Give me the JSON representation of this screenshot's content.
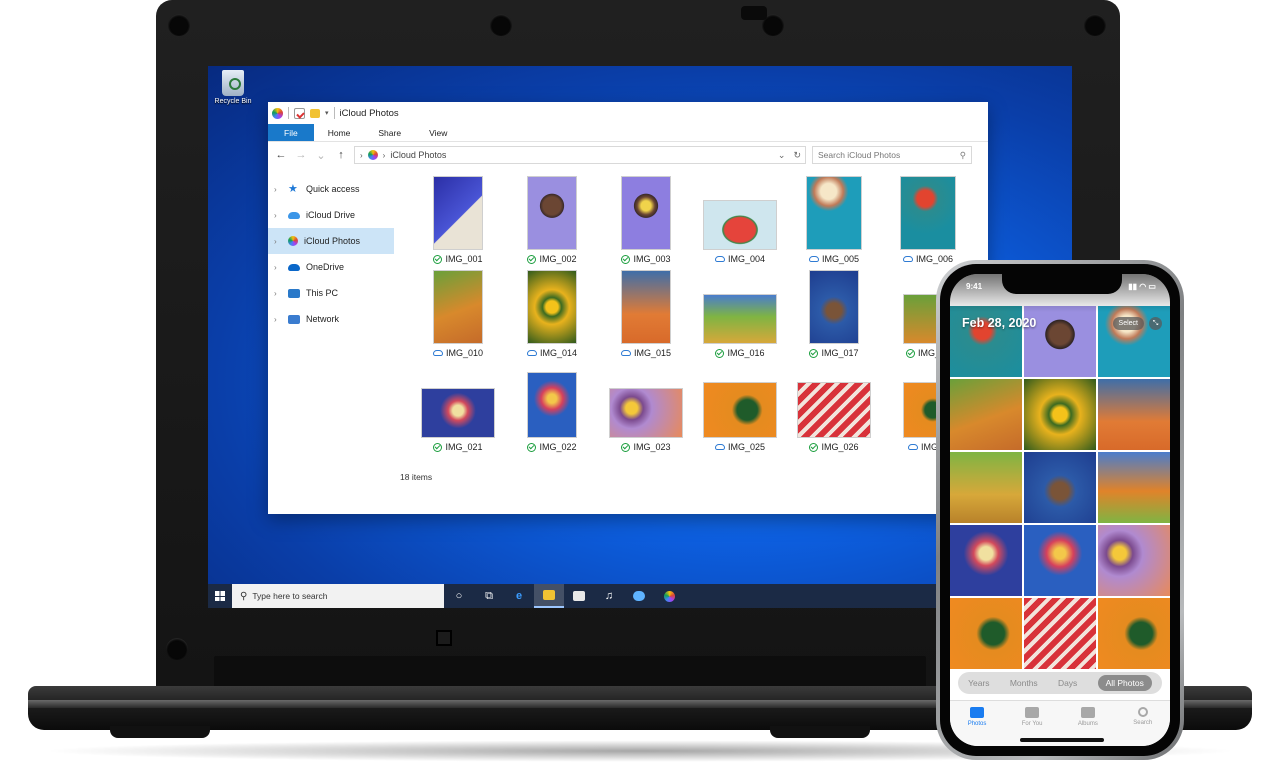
{
  "desktop": {
    "recycle_bin": "Recycle Bin"
  },
  "explorer": {
    "title": "iCloud Photos",
    "ribbon_tabs": [
      "File",
      "Home",
      "Share",
      "View"
    ],
    "address": "iCloud Photos",
    "search_placeholder": "Search iCloud Photos",
    "nav": [
      {
        "label": "Quick access",
        "icon": "star-icon"
      },
      {
        "label": "iCloud Drive",
        "icon": "cloud-icon"
      },
      {
        "label": "iCloud Photos",
        "icon": "photos-icon",
        "selected": true
      },
      {
        "label": "OneDrive",
        "icon": "onedrive-icon"
      },
      {
        "label": "This PC",
        "icon": "pc-icon"
      },
      {
        "label": "Network",
        "icon": "network-icon"
      }
    ],
    "files": [
      {
        "name": "IMG_001",
        "status": "synced"
      },
      {
        "name": "IMG_002",
        "status": "synced"
      },
      {
        "name": "IMG_003",
        "status": "synced"
      },
      {
        "name": "IMG_004",
        "status": "cloud"
      },
      {
        "name": "IMG_005",
        "status": "cloud"
      },
      {
        "name": "IMG_006",
        "status": "cloud"
      },
      {
        "name": "IMG_010",
        "status": "cloud"
      },
      {
        "name": "IMG_014",
        "status": "cloud"
      },
      {
        "name": "IMG_015",
        "status": "cloud"
      },
      {
        "name": "IMG_016",
        "status": "synced"
      },
      {
        "name": "IMG_017",
        "status": "synced"
      },
      {
        "name": "IMG_01",
        "status": "synced"
      },
      {
        "name": "IMG_021",
        "status": "synced"
      },
      {
        "name": "IMG_022",
        "status": "synced"
      },
      {
        "name": "IMG_023",
        "status": "synced"
      },
      {
        "name": "IMG_025",
        "status": "cloud"
      },
      {
        "name": "IMG_026",
        "status": "synced"
      },
      {
        "name": "IMG_0",
        "status": "cloud"
      }
    ],
    "status_text": "18 items"
  },
  "taskbar": {
    "search_placeholder": "Type here to search"
  },
  "phone": {
    "time": "9:41",
    "date_header": "Feb 28, 2020",
    "select_label": "Select",
    "segments": [
      "Years",
      "Months",
      "Days",
      "All Photos"
    ],
    "active_segment": "All Photos",
    "tabs": [
      "Photos",
      "For You",
      "Albums",
      "Search"
    ],
    "active_tab": "Photos"
  }
}
